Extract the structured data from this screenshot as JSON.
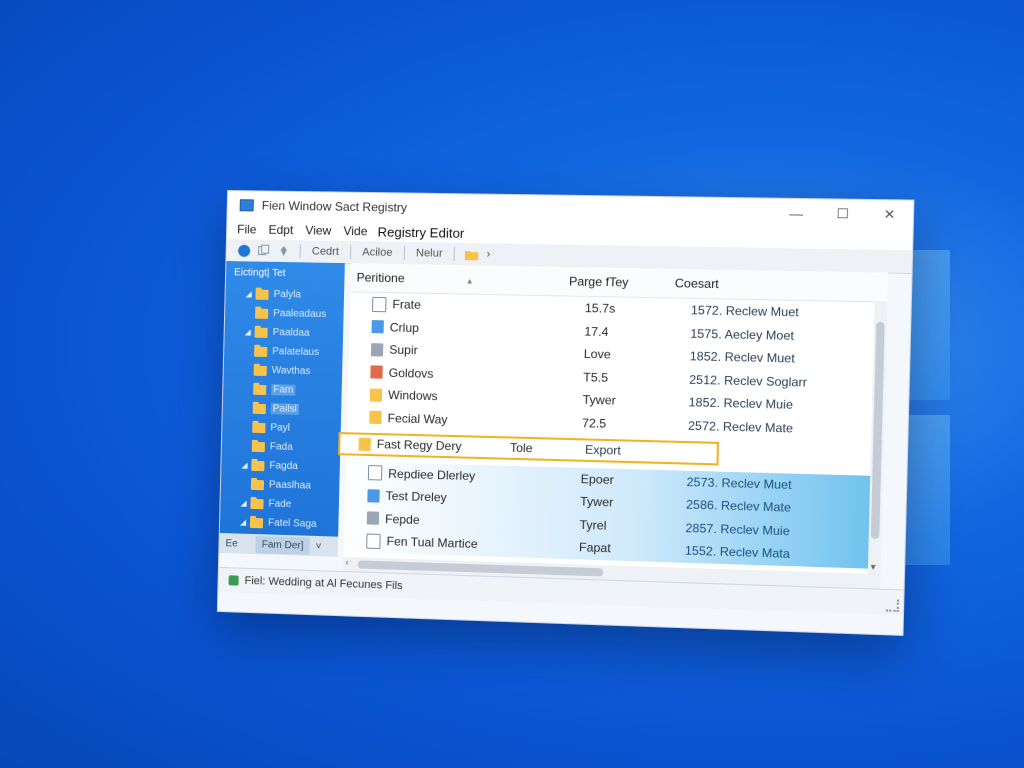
{
  "window": {
    "title": "Fien Window Sact Registry",
    "controls": {
      "minimize": "—",
      "maximize": "☐",
      "close": "✕"
    }
  },
  "menu": {
    "items": [
      "File",
      "Edpt",
      "View",
      "Vide"
    ],
    "app_title": "Registry Editor"
  },
  "toolbar": {
    "labels": [
      "Cedrt",
      "Aciloe",
      "Nelur"
    ],
    "arrow": "›"
  },
  "tree": {
    "header": "Eictingt| Tet",
    "items": [
      {
        "label": "Palyla",
        "expandable": true,
        "selected": false
      },
      {
        "label": "Paaleadaus",
        "expandable": false,
        "selected": false
      },
      {
        "label": "Paaldaa",
        "expandable": true,
        "selected": false
      },
      {
        "label": "Palatelaus",
        "expandable": false,
        "selected": false
      },
      {
        "label": "Wavthas",
        "expandable": false,
        "selected": false
      },
      {
        "label": "Fam",
        "expandable": false,
        "selected": true
      },
      {
        "label": "Pailsl",
        "expandable": false,
        "selected": true
      },
      {
        "label": "Payl",
        "expandable": false,
        "selected": false
      },
      {
        "label": "Fada",
        "expandable": false,
        "selected": false
      },
      {
        "label": "Fagda",
        "expandable": true,
        "selected": false
      },
      {
        "label": "Paaslhaa",
        "expandable": false,
        "selected": false
      },
      {
        "label": "Fade",
        "expandable": true,
        "selected": false
      },
      {
        "label": "Fatel Saga",
        "expandable": true,
        "selected": false
      }
    ],
    "tabs": [
      "Ee",
      "Fam Der]",
      "˅"
    ]
  },
  "list": {
    "columns": [
      "Peritione",
      "Parge fTey",
      "Coesart"
    ],
    "rows": [
      {
        "name": "Frate",
        "type": "15.7s",
        "data": "1572. Reclew Muet",
        "icon": "ri-file",
        "state": "normal"
      },
      {
        "name": "Crlup",
        "type": "17.4",
        "data": "1575. Aecley Moet",
        "icon": "ri-blue",
        "state": "normal"
      },
      {
        "name": "Supir",
        "type": "Love",
        "data": "1852. Reclev Muet",
        "icon": "ri-gray",
        "state": "normal"
      },
      {
        "name": "Goldovs",
        "type": "T5.5",
        "data": "2512. Reclev Soglarr",
        "icon": "ri-red",
        "state": "normal"
      },
      {
        "name": "Windows",
        "type": "Tywer",
        "data": "1852. Reclev Muie",
        "icon": "ri-folder",
        "state": "normal"
      },
      {
        "name": "Fecial Way",
        "type": "72.5",
        "data": "2572. Reclev Mate",
        "icon": "ri-folder",
        "state": "normal"
      },
      {
        "name": "Fast Regy Dery",
        "type": "Tole",
        "data": "Export",
        "icon": "ri-folder",
        "state": "highlighted"
      },
      {
        "name": "Repdiee Dlerley",
        "type": "Epoer",
        "data": "2573. Reclev Muet",
        "icon": "ri-file",
        "state": "tinted"
      },
      {
        "name": "Test Dreley",
        "type": "Tywer",
        "data": "2586. Reclev Mate",
        "icon": "ri-blue",
        "state": "tinted"
      },
      {
        "name": "Fepde",
        "type": "Tyrel",
        "data": "2857. Reclev Muie",
        "icon": "ri-gray",
        "state": "tinted"
      },
      {
        "name": "Fen Tual Martice",
        "type": "Fapat",
        "data": "1552. Reclev Mata",
        "icon": "ri-file",
        "state": "tinted"
      }
    ]
  },
  "status": {
    "text": "Fiel: Wedding at Al Fecunes Fils"
  },
  "colors": {
    "accent_highlight": "#f1b322",
    "desktop_blue": "#0a55d4",
    "tree_blue": "#1f74d8"
  }
}
